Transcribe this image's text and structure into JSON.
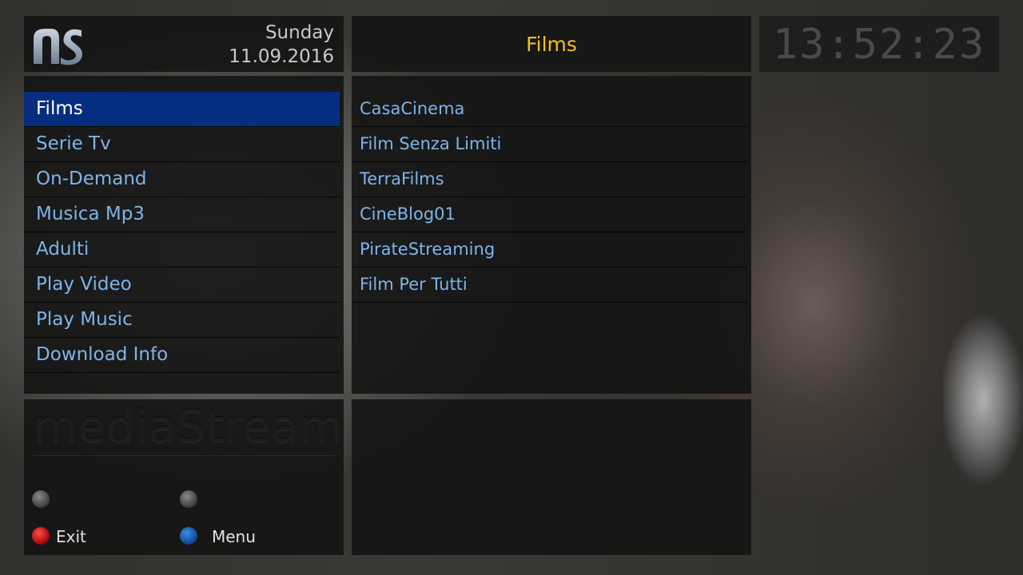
{
  "header": {
    "day": "Sunday",
    "date": "11.09.2016",
    "title": "Films",
    "clock": "13:52:23",
    "logo_icon": "ms-logo-icon"
  },
  "menu": {
    "items": [
      {
        "label": "Films",
        "selected": true
      },
      {
        "label": "Serie Tv"
      },
      {
        "label": "On-Demand"
      },
      {
        "label": "Musica Mp3"
      },
      {
        "label": "Adulti"
      },
      {
        "label": "Play Video"
      },
      {
        "label": "Play Music"
      },
      {
        "label": "Download Info"
      }
    ]
  },
  "submenu": {
    "items": [
      {
        "label": "CasaCinema"
      },
      {
        "label": "Film Senza Limiti"
      },
      {
        "label": "TerraFilms"
      },
      {
        "label": "CineBlog01"
      },
      {
        "label": "PirateStreaming"
      },
      {
        "label": "Film Per Tutti"
      }
    ]
  },
  "footer": {
    "wordmark": "mediaStream",
    "buttons": [
      {
        "color": "grey",
        "label": ""
      },
      {
        "color": "grey",
        "label": ""
      },
      {
        "color": "red",
        "label": "Exit"
      },
      {
        "color": "blue",
        "label": "Menu"
      }
    ]
  },
  "colors": {
    "accent_title": "#f0c020",
    "item_text": "#7fb4e8",
    "selected_bg": "#052d80"
  }
}
